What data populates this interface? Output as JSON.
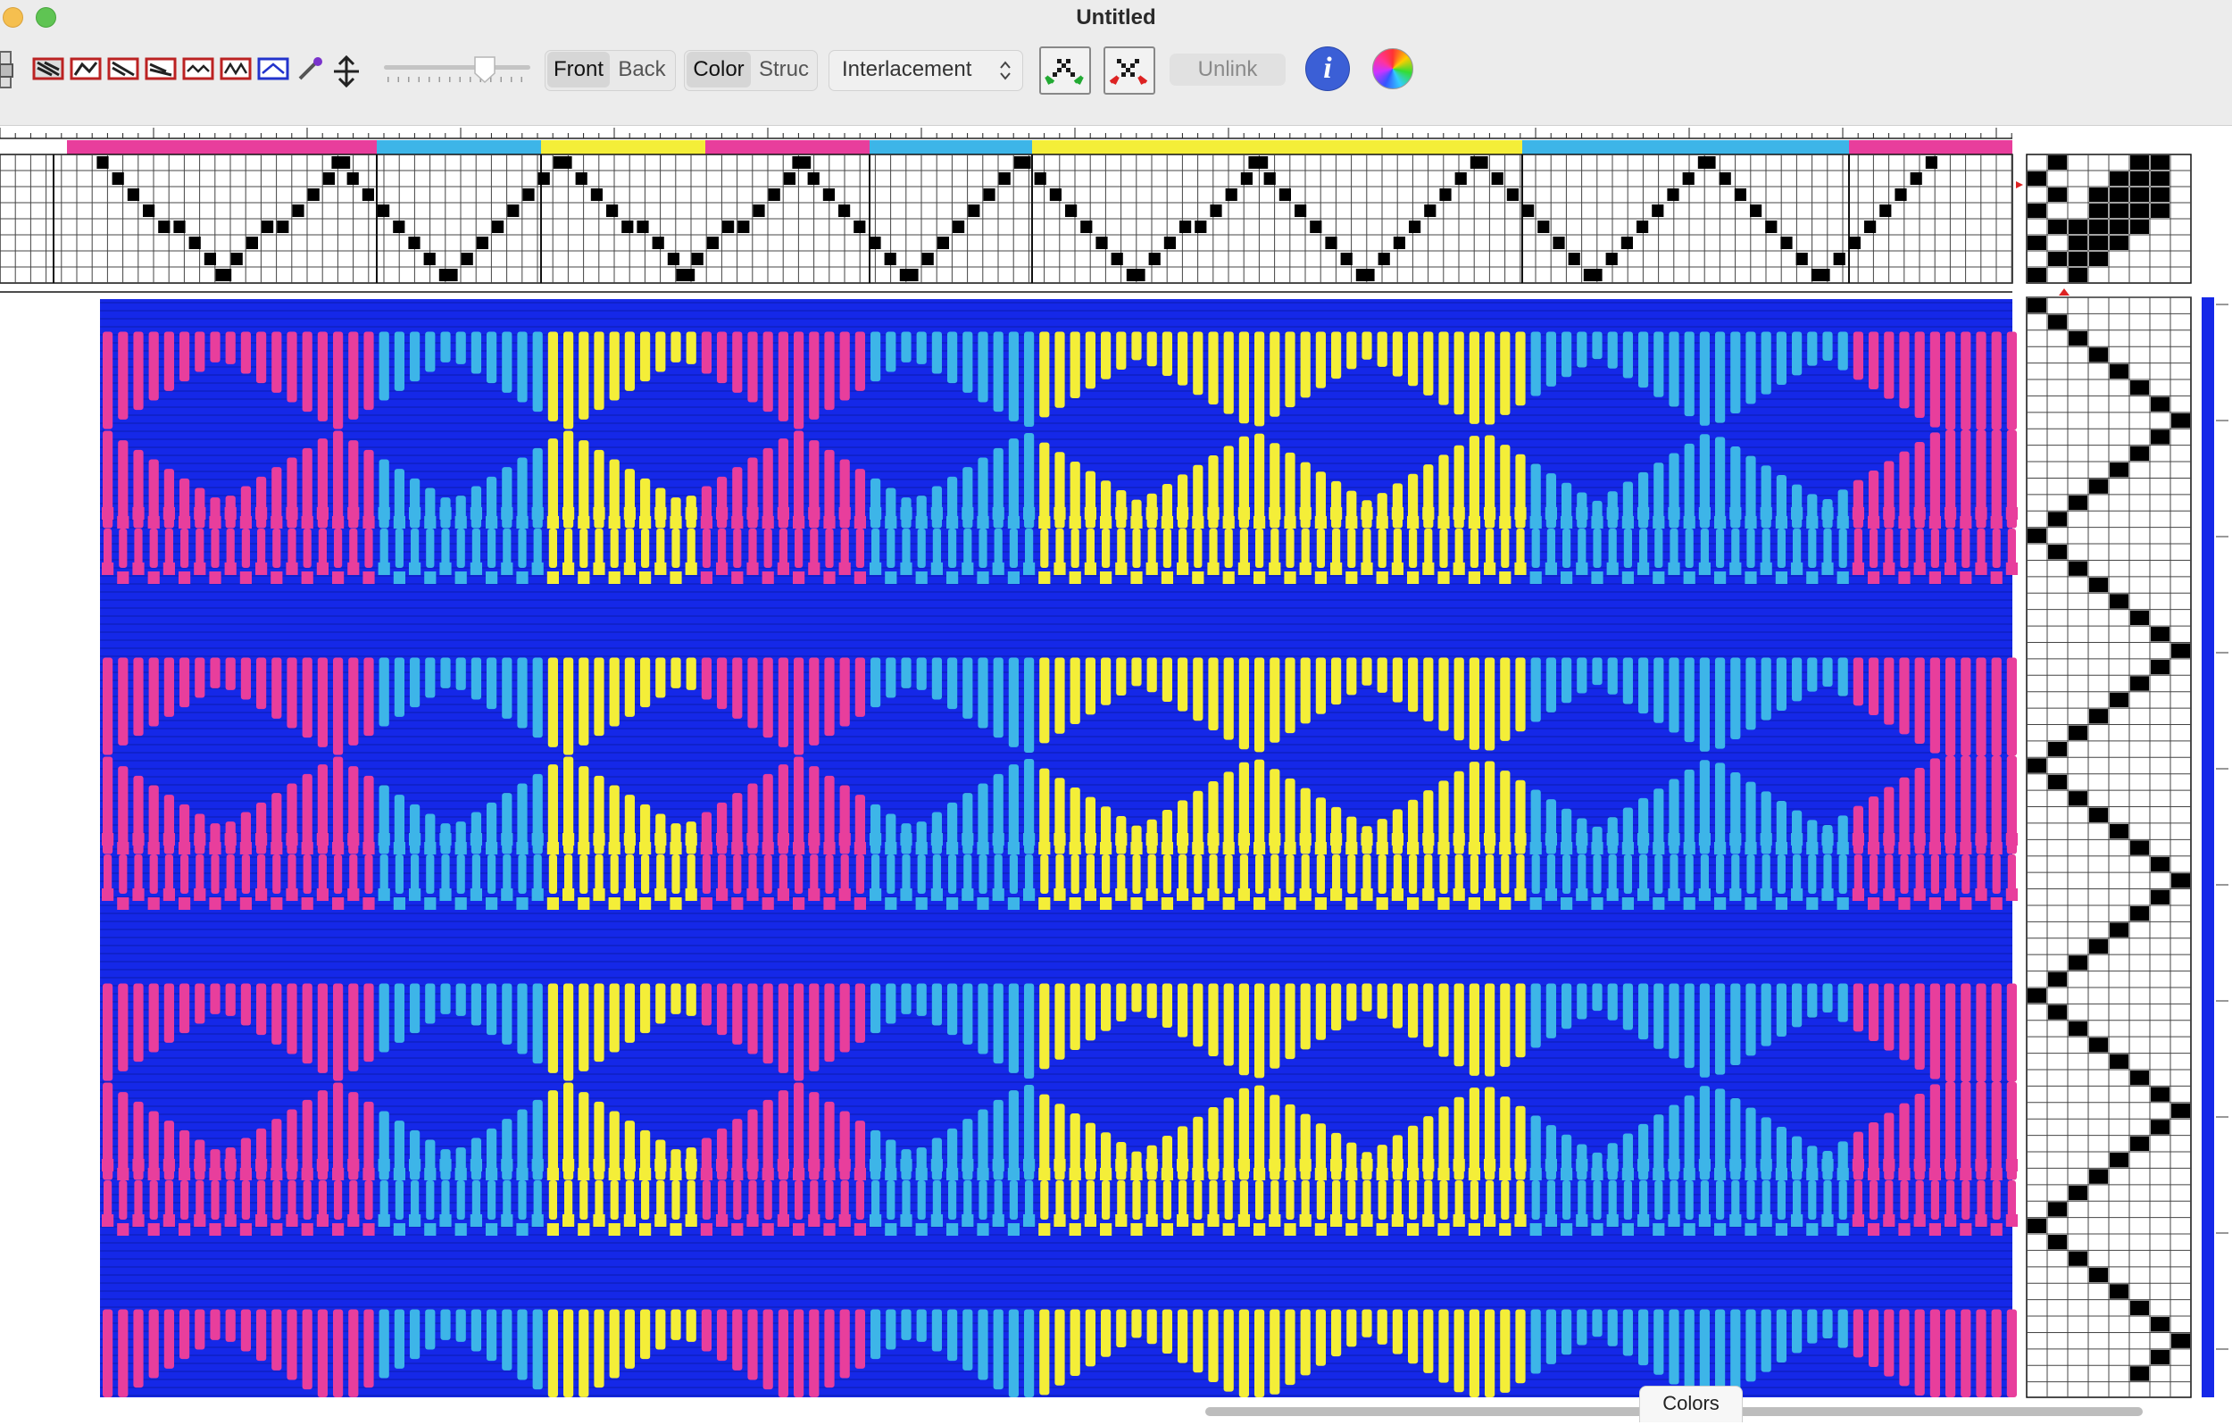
{
  "window": {
    "title": "Untitled"
  },
  "toolbar": {
    "front_label": "Front",
    "back_label": "Back",
    "color_label": "Color",
    "struc_label": "Struc",
    "view_mode": "Interlacement",
    "unlink_label": "Unlink",
    "info_label": "i"
  },
  "colors_tab": {
    "label": "Colors"
  },
  "colors": {
    "ground": "#1528e8",
    "magenta": "#e83e9c",
    "cyan": "#3db5e8",
    "yellow": "#f4ee38"
  },
  "icons": [
    "close-icon",
    "minimize-icon",
    "zoom-icon",
    "draw-tool-icon",
    "color-picker-icon",
    "flip-icon",
    "swap-green-icon",
    "swap-red-icon",
    "info-icon",
    "color-wheel-icon"
  ]
}
